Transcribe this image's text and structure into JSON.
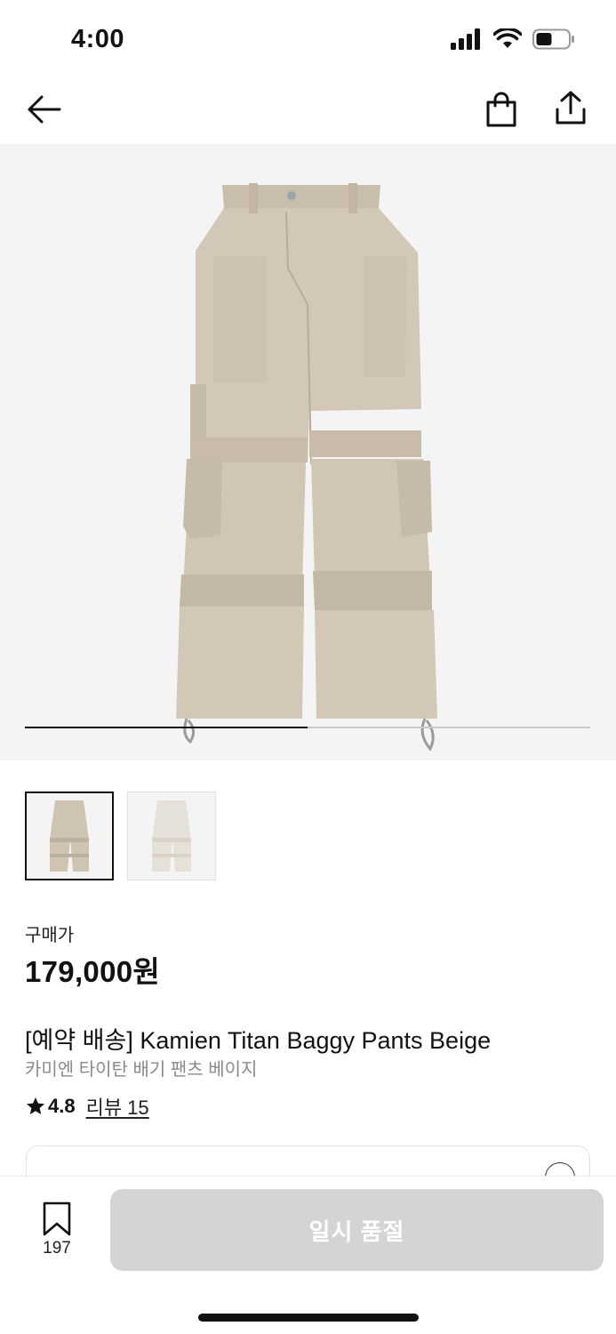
{
  "status_bar": {
    "time": "4:00",
    "icons": [
      "signal-icon",
      "wifi-icon",
      "battery-icon"
    ]
  },
  "nav": {
    "icons": [
      "back-arrow-icon",
      "shopping-bag-icon",
      "share-icon"
    ]
  },
  "gallery": {
    "progress": 0.5,
    "image_count": 2,
    "active_index": 0
  },
  "product": {
    "price_label": "구매가",
    "price": "179,000원",
    "title": "[예약 배송] Kamien Titan Baggy Pants Beige",
    "subtitle": "카미엔 타이탄 배기 팬츠 베이지",
    "rating": "4.8",
    "review_label": "리뷰 15"
  },
  "bottom": {
    "save_count": "197",
    "button_label": "일시 품절"
  },
  "colors": {
    "pants_main": "#d3c8b8",
    "pants_shadow": "#bfb3a2",
    "thumb2_main": "#e7e2d9",
    "soldout_bg": "#d4d4d4"
  }
}
